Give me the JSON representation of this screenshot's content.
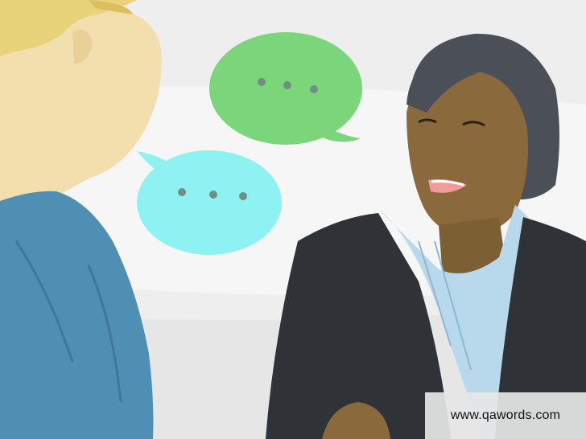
{
  "watermark": {
    "text": "www.qawords.com"
  },
  "colors": {
    "background": "#eeeeee",
    "green_bubble": "#7bd67b",
    "cyan_bubble": "#8ff2f2",
    "bubble_dots": "#6f8f83",
    "blonde_hair": "#e8d27a",
    "light_skin": "#f3dfae",
    "blue_shirt": "#4f8fb3",
    "dark_skin": "#8a6a3c",
    "dark_hair": "#4a4f58",
    "blazer": "#2f3338",
    "striped_shirt": "#b8d9ec"
  },
  "icons": {
    "green_bubble": "speech-bubble-ellipsis-icon",
    "cyan_bubble": "speech-bubble-ellipsis-icon"
  }
}
